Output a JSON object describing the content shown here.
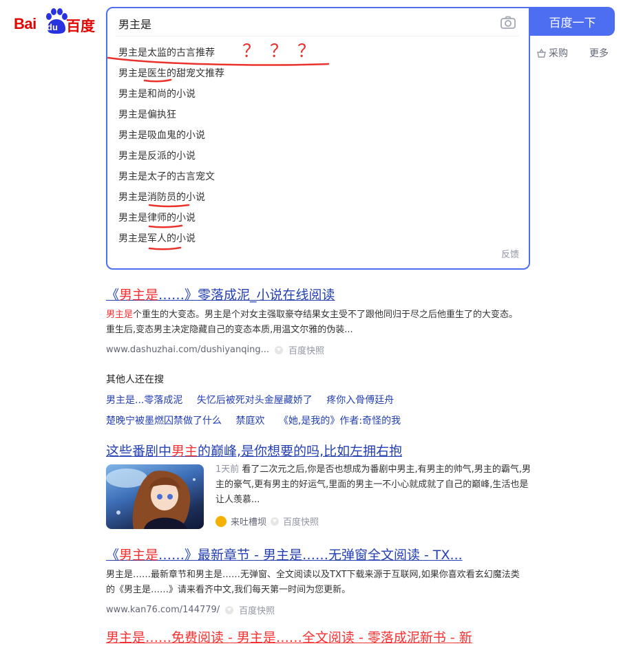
{
  "logo": {
    "latin": "Bai",
    "du": "du",
    "chinese": "百度"
  },
  "search": {
    "query": "男主是",
    "button_label": "百度一下",
    "suggestions": [
      {
        "prefix": "男主是",
        "rest": "太监的古言推荐"
      },
      {
        "prefix": "男主是",
        "rest": "医生的甜宠文推荐"
      },
      {
        "prefix": "男主是",
        "rest": "和尚的小说"
      },
      {
        "prefix": "男主是",
        "rest": "偏执狂"
      },
      {
        "prefix": "男主是",
        "rest": "吸血鬼的小说"
      },
      {
        "prefix": "男主是",
        "rest": "反派的小说"
      },
      {
        "prefix": "男主是",
        "rest": "太子的古言宠文"
      },
      {
        "prefix": "男主是",
        "rest": "消防员的小说"
      },
      {
        "prefix": "男主是",
        "rest": "律师的小说"
      },
      {
        "prefix": "男主是",
        "rest": "军人的小说"
      }
    ],
    "feedback": "反馈"
  },
  "header_links": {
    "buy": "采购",
    "more": "更多"
  },
  "annotation": {
    "question_marks": "？？？",
    "color": "#e8322b"
  },
  "results": [
    {
      "title_pre": "《",
      "title_hl": "男主是",
      "title_post": "……》零落成泥_小说在线阅读",
      "desc_hl": "男主是",
      "desc": "个重生的大变态。男主是个对女主强取豪夺结果女主受不了跟他同归于尽之后他重生了的大变态。 重生后,变态男主决定隐藏自己的变态本质,用温文尔雅的伪装...",
      "url": "www.dashuzhai.com/dushiyanqing...",
      "snapshot": "百度快照"
    },
    {
      "title_pre": "这些番剧中",
      "title_hl": "男主",
      "title_post": "的巅峰,是你想要的吗,比如左拥右抱",
      "time": "1天前",
      "desc": "看了二次元之后,你是否也想成为番剧中男主,有男主的帅气,男主的霸气,男主的豪气,更有男主的好运气,里面的男主一不小心就成就了自己的巅峰,生活也是让人羡慕...",
      "source": "来吐槽坝",
      "snapshot": "百度快照"
    },
    {
      "title_pre": "《",
      "title_hl": "男主是",
      "title_post": "……》最新章节 - 男主是……无弹窗全文阅读 - TX...",
      "desc": "男主是……最新章节和男主是……无弹窗、全文阅读以及TXT下载来源于互联网,如果你喜欢看玄幻魔法类的《男主是……》请来看齐中文,我们每天第一时间为您更新。",
      "url": "www.kan76.com/144779/",
      "snapshot": "百度快照"
    },
    {
      "title_partial": "男主是……免费阅读 - 男主是……全文阅读 - 零落成泥新书 - 新"
    }
  ],
  "others": {
    "title": "其他人还在搜",
    "row1": [
      "男主是...零落成泥",
      "失忆后被死对头金屋藏娇了",
      "疼你入骨傅廷舟"
    ],
    "row2": [
      "楚晚宁被墨燃囚禁做了什么",
      "禁庭欢",
      "《她,是我的》作者:奇怪的我"
    ]
  }
}
